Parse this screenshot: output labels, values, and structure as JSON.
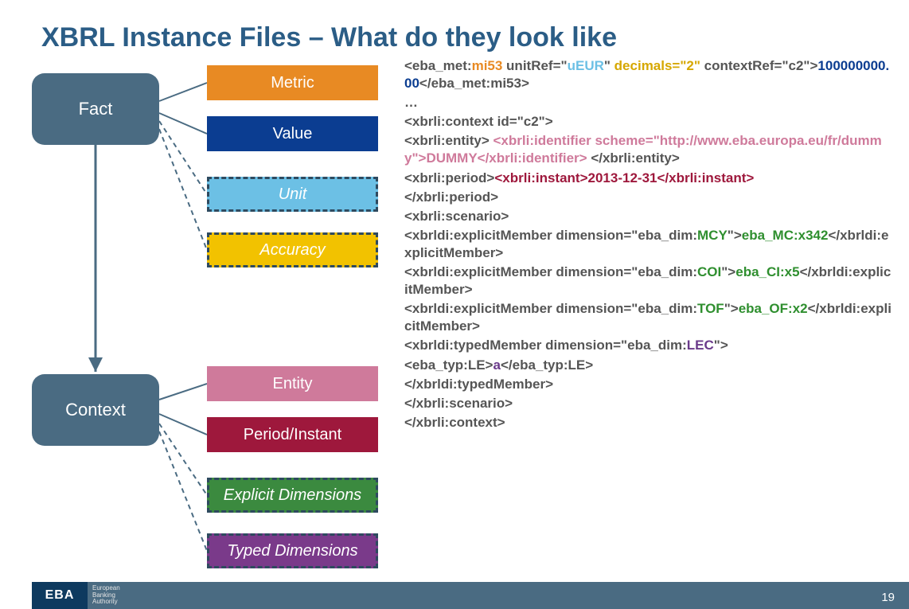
{
  "title": "XBRL Instance Files – What do they look like",
  "diagram": {
    "fact": "Fact",
    "context": "Context",
    "chips": {
      "metric": "Metric",
      "value": "Value",
      "unit": "Unit",
      "accuracy": "Accuracy",
      "entity": "Entity",
      "period": "Period/Instant",
      "expldim": "Explicit Dimensions",
      "typeddim": "Typed Dimensions"
    }
  },
  "code": {
    "l1a": "<eba_met:",
    "l1b": "mi53",
    "l1c": " unitRef=\"",
    "l1d": "uEUR",
    "l1e": "\" ",
    "l1f": "decimals=\"2\"",
    "l1g": " contextRef=\"c2\">",
    "l1h": "100000000.00",
    "l1i": "</eba_met:mi53>",
    "l2": "…",
    "l3": "<xbrli:context id=\"c2\">",
    "l4a": " <xbrli:entity> ",
    "l4b": "<xbrli:identifier scheme=\"http://www.eba.europa.eu/fr/dummy\">DUMMY</xbrli:identifier>",
    "l4c": " </xbrli:entity>",
    "l5a": " <xbrli:period>",
    "l5b": "<xbrli:instant>2013-12-31</xbrli:instant>",
    "l5c": "</xbrli:period>",
    "l6": "  <xbrli:scenario>",
    "l7a": "   <xbrldi:explicitMember dimension=\"eba_dim:",
    "l7b": "MCY",
    "l7c": "\">",
    "l7d": "eba_MC:x342",
    "l7e": "</xbrldi:explicitMember>",
    "l8a": "   <xbrldi:explicitMember dimension=\"eba_dim:",
    "l8b": "COI",
    "l8c": "\">",
    "l8d": "eba_CI:x5",
    "l8e": "</xbrldi:explicitMember>",
    "l9a": "   <xbrldi:explicitMember dimension=\"eba_dim:",
    "l9b": "TOF",
    "l9c": "\">",
    "l9d": "eba_OF:x2",
    "l9e": "</xbrldi:explicitMember>",
    "l10a": "<xbrldi:typedMember dimension=\"eba_dim:",
    "l10b": "LEC",
    "l10c": "\">",
    "l11a": "       <eba_typ:LE>",
    "l11b": "a",
    "l11c": "</eba_typ:LE>",
    "l12": "      </xbrldi:typedMember>",
    "l13": "  </xbrli:scenario>",
    "l14": " </xbrli:context>"
  },
  "footer": {
    "eba": "EBA",
    "sub1": "European",
    "sub2": "Banking",
    "sub3": "Authority",
    "page": "19"
  }
}
